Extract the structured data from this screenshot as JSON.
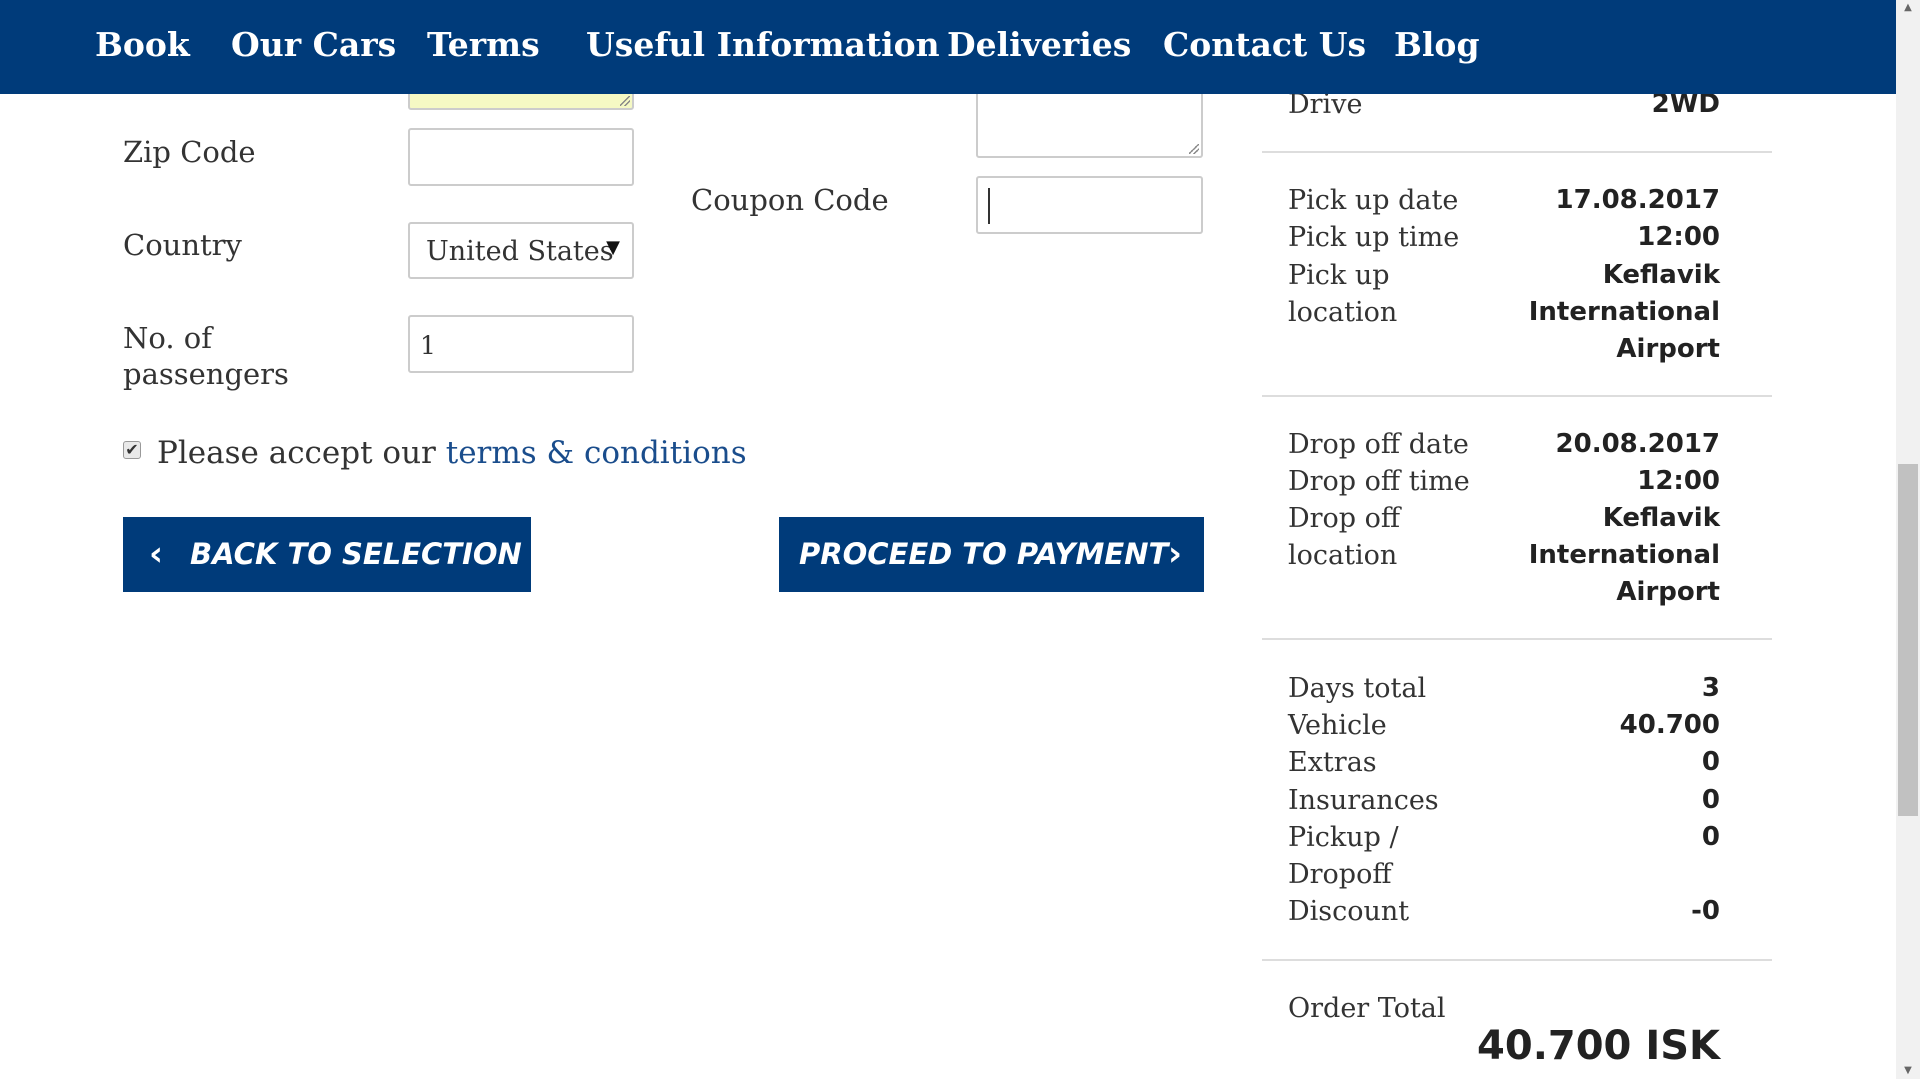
{
  "nav": {
    "items": [
      "Book",
      "Our Cars",
      "Terms",
      "Useful Information",
      "Deliveries",
      "Contact Us",
      "Blog"
    ]
  },
  "form": {
    "zip_label": "Zip Code",
    "zip_value": "",
    "country_label": "Country",
    "country_value": "United States",
    "passengers_label_line1": "No. of",
    "passengers_label_line2": "passengers",
    "passengers_value": "1",
    "coupon_label": "Coupon Code",
    "coupon_value": "",
    "accept_text": "Please accept our",
    "terms_link": "terms & conditions",
    "terms_checked": true
  },
  "buttons": {
    "back": "BACK TO SELECTION",
    "proceed": "PROCEED TO PAYMENT"
  },
  "summary": {
    "drive_label": "Drive",
    "drive_value": "2WD",
    "pickup_date_label": "Pick up date",
    "pickup_date_value": "17.08.2017",
    "pickup_time_label": "Pick up time",
    "pickup_time_value": "12:00",
    "pickup_location_label_1": "Pick up",
    "pickup_location_label_2": "location",
    "pickup_location_value_1": "Keflavik",
    "pickup_location_value_2": "International",
    "pickup_location_value_3": "Airport",
    "dropoff_date_label": "Drop off date",
    "dropoff_date_value": "20.08.2017",
    "dropoff_time_label": "Drop off time",
    "dropoff_time_value": "12:00",
    "dropoff_location_label_1": "Drop off",
    "dropoff_location_label_2": "location",
    "dropoff_location_value_1": "Keflavik",
    "dropoff_location_value_2": "International",
    "dropoff_location_value_3": "Airport",
    "days_total_label": "Days total",
    "days_total_value": "3",
    "vehicle_label": "Vehicle",
    "vehicle_value": "40.700",
    "extras_label": "Extras",
    "extras_value": "0",
    "insurances_label": "Insurances",
    "insurances_value": "0",
    "pickup_dropoff_label_1": "Pickup /",
    "pickup_dropoff_label_2": "Dropoff",
    "pickup_dropoff_value": "0",
    "discount_label": "Discount",
    "discount_value": "-0",
    "order_total_label": "Order Total",
    "order_total_value": "40.700 ISK"
  },
  "colors": {
    "brand": "#003b7a",
    "link": "#1a4d8c",
    "highlight_field": "#f5f9c4"
  }
}
